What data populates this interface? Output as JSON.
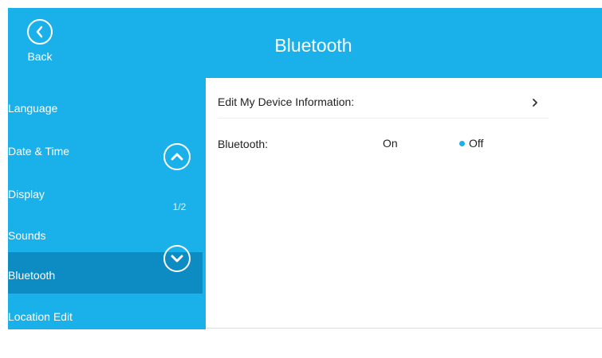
{
  "header": {
    "back_label": "Back",
    "title": "Bluetooth"
  },
  "sidebar": {
    "items": [
      {
        "label": "Language",
        "selected": false
      },
      {
        "label": "Date & Time",
        "selected": false
      },
      {
        "label": "Display",
        "selected": false
      },
      {
        "label": "Sounds",
        "selected": false
      },
      {
        "label": "Bluetooth",
        "selected": true
      },
      {
        "label": "Location Edit",
        "selected": false
      }
    ],
    "page_indicator": "1/2",
    "scroll_up_icon": "chevron-up-icon",
    "scroll_down_icon": "chevron-down-icon"
  },
  "content": {
    "edit_device": {
      "label": "Edit My Device Information:",
      "icon": "chevron-right-icon"
    },
    "bluetooth": {
      "label": "Bluetooth:",
      "options": [
        {
          "label": "On",
          "selected": false
        },
        {
          "label": "Off",
          "selected": true
        }
      ]
    }
  },
  "colors": {
    "accent": "#1ab0ea",
    "selected_item": "#0d8cc4",
    "radio_selected": "#1ab0ea"
  }
}
